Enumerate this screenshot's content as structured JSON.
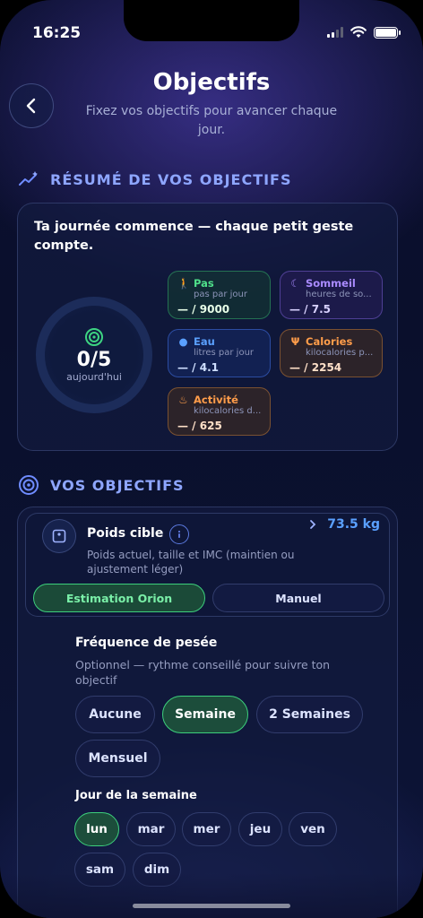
{
  "status": {
    "time": "16:25"
  },
  "header": {
    "title": "Objectifs",
    "subtitle": "Fixez vos objectifs pour avancer chaque jour."
  },
  "summary": {
    "section_title": "RÉSUMÉ DE VOS OBJECTIFS",
    "tagline": "Ta journée commence — chaque petit geste compte.",
    "ring_value": "0/5",
    "ring_label": "aujourd'hui",
    "goals": [
      {
        "name": "Pas",
        "sub": "pas par jour",
        "value": "— / 9000",
        "icon": "walk-icon",
        "color": "#4fe08a"
      },
      {
        "name": "Sommeil",
        "sub": "heures de so...",
        "value": "— / 7.5",
        "icon": "moon-icon",
        "color": "#a98bff"
      },
      {
        "name": "Eau",
        "sub": "litres par jour",
        "value": "— / 4.1",
        "icon": "drop-icon",
        "color": "#5aa0ff"
      },
      {
        "name": "Calories",
        "sub": "kilocalories p...",
        "value": "— / 2254",
        "icon": "utensils-icon",
        "color": "#ff9d4a"
      },
      {
        "name": "Activité",
        "sub": "kilocalories d...",
        "value": "— / 625",
        "icon": "flame-icon",
        "color": "#ff9d4a"
      }
    ]
  },
  "goals": {
    "section_title": "VOS OBJECTIFS",
    "weight": {
      "title": "Poids cible",
      "value": "73.5 kg",
      "description": "Poids actuel, taille et IMC (maintien ou ajustement léger)",
      "mode_orion": "Estimation Orion",
      "mode_manual": "Manuel"
    },
    "frequency": {
      "title": "Fréquence de pesée",
      "description": "Optionnel — rythme conseillé pour suivre ton objectif",
      "options": [
        "Aucune",
        "Semaine",
        "2 Semaines",
        "Mensuel"
      ],
      "selected": "Semaine"
    },
    "weekday": {
      "title": "Jour de la semaine",
      "days": [
        "lun",
        "mar",
        "mer",
        "jeu",
        "ven",
        "sam",
        "dim"
      ],
      "selected": "lun"
    }
  }
}
